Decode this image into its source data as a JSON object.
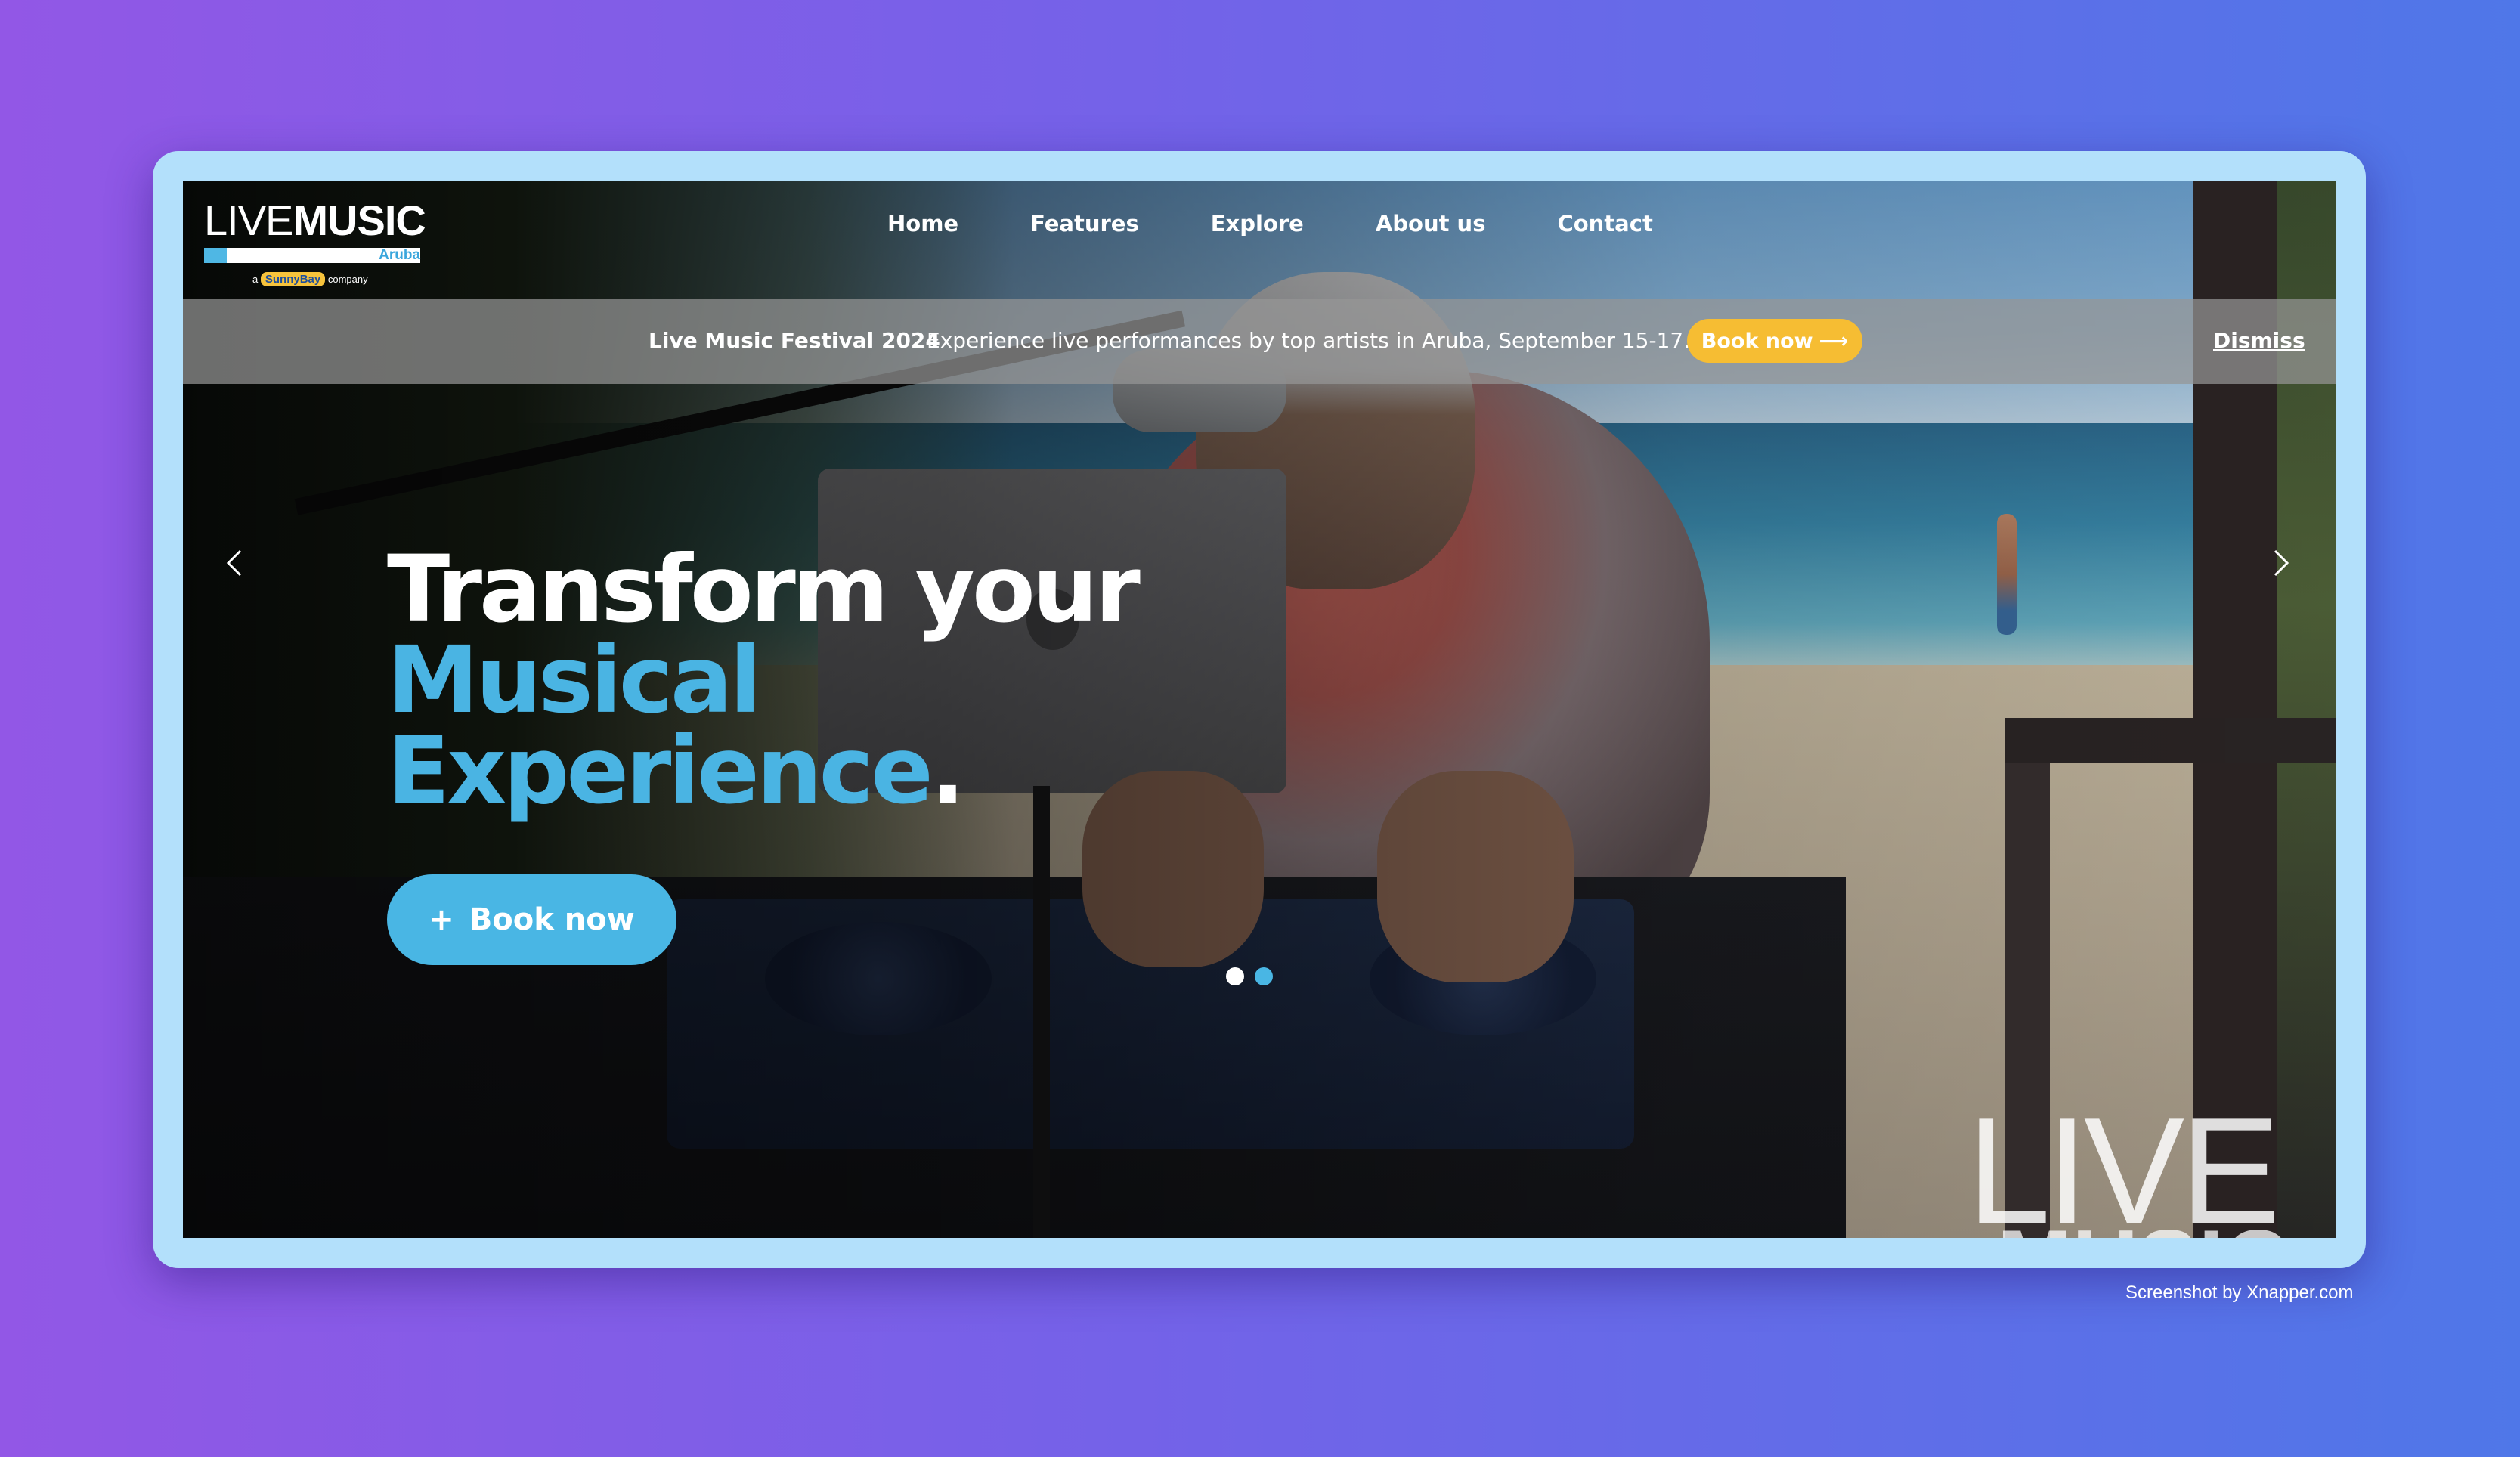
{
  "logo": {
    "text_light": "LIVE",
    "text_bold": "MUSIC",
    "sub": "Aruba",
    "company_prefix": "a",
    "company_brand": "SunnyBay",
    "company_suffix": "company"
  },
  "nav": {
    "items": [
      {
        "label": "Home"
      },
      {
        "label": "Features"
      },
      {
        "label": "Explore"
      },
      {
        "label": "About us"
      },
      {
        "label": "Contact"
      }
    ]
  },
  "banner": {
    "title": "Live Music Festival 2024",
    "text": "Experience live performances by top artists in Aruba, September 15-17.",
    "cta_label": "Book now",
    "cta_arrow": "⟶",
    "dismiss_label": "Dismiss"
  },
  "hero": {
    "line1": "Transform your",
    "line2": "Musical",
    "line3": "Experience",
    "line3_dot": ".",
    "button_plus": "+",
    "button_label": "Book now",
    "watermark_line1": "LIVE",
    "watermark_line2": "MUSIC"
  },
  "carousel": {
    "slide_count": 2,
    "active_slide": 1
  },
  "credit": "Screenshot by Xnapper.com",
  "colors": {
    "accent_blue": "#49b6e4",
    "cta_yellow": "#f6bd33",
    "frame": "#b3e0fb",
    "bg_start": "#9257e6",
    "bg_end": "#4f77e8"
  },
  "icons": {
    "prev": "chevron-left-icon",
    "next": "chevron-right-icon",
    "cta_arrow": "arrow-right-icon"
  }
}
